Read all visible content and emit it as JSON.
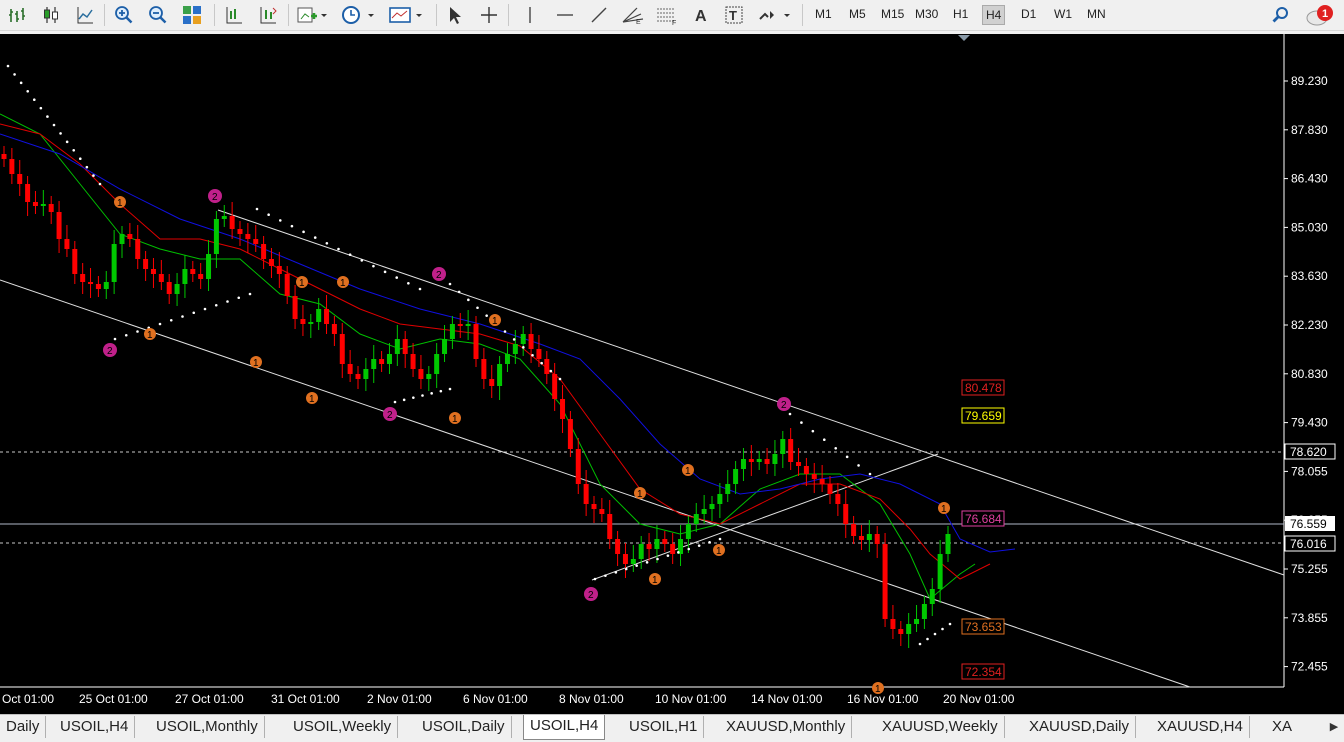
{
  "toolbar": {
    "icons": [
      "bar-chart-icon",
      "candlestick-icon",
      "line-chart-icon",
      "zoom-in-icon",
      "zoom-out-icon",
      "tile-windows-icon",
      "chart-shift-icon",
      "autoscroll-icon",
      "add-indicator-icon",
      "periods-clock-icon",
      "templates-icon",
      "cursor-icon",
      "crosshair-icon",
      "vertical-line-icon",
      "horizontal-line-icon",
      "trendline-icon",
      "fibonacci-fan-icon",
      "fibonacci-icon",
      "text-icon",
      "text-label-icon",
      "arrows-icon",
      "search-icon",
      "notifications-icon"
    ],
    "timeframes": [
      "M1",
      "M5",
      "M15",
      "M30",
      "H1",
      "H4",
      "D1",
      "W1",
      "MN"
    ],
    "active_timeframe": "H4",
    "notification_count": "1"
  },
  "chart": {
    "symbol": "USOIL,H4",
    "price_labels": [
      "89.230",
      "87.830",
      "86.430",
      "85.030",
      "83.630",
      "82.230",
      "80.830",
      "79.430",
      "78.055",
      "76.655",
      "75.255",
      "73.855",
      "72.455"
    ],
    "date_labels": [
      "Oct 01:00",
      "25 Oct 01:00",
      "27 Oct 01:00",
      "31 Oct 01:00",
      "2 Nov 01:00",
      "6 Nov 01:00",
      "8 Nov 01:00",
      "10 Nov 01:00",
      "14 Nov 01:00",
      "16 Nov 01:00",
      "20 Nov 01:00"
    ],
    "current_price": "76.559",
    "level_labels": {
      "l78620": "78.620",
      "l76016": "76.016",
      "l80478": "80.478",
      "l79659": "79.659",
      "l76684": "76.684",
      "l73653": "73.653",
      "l72354": "72.354"
    },
    "colors": {
      "background": "#000000",
      "bull": "#00c800",
      "bear": "#ff0000",
      "ma_fast": "#00c000",
      "ma_mid": "#e00000",
      "ma_slow": "#1010e0",
      "marker_1": "#e07020",
      "marker_2": "#c0208a"
    }
  },
  "tabs": [
    "Daily",
    "USOIL,H4",
    "USOIL,Monthly",
    "USOIL,Weekly",
    "USOIL,Daily",
    "USOIL,H4",
    "USOIL,H1",
    "XAUUSD,Monthly",
    "XAUUSD,Weekly",
    "XAUUSD,Daily",
    "XAUUSD,H4",
    "XA"
  ],
  "active_tab_index": 5
}
